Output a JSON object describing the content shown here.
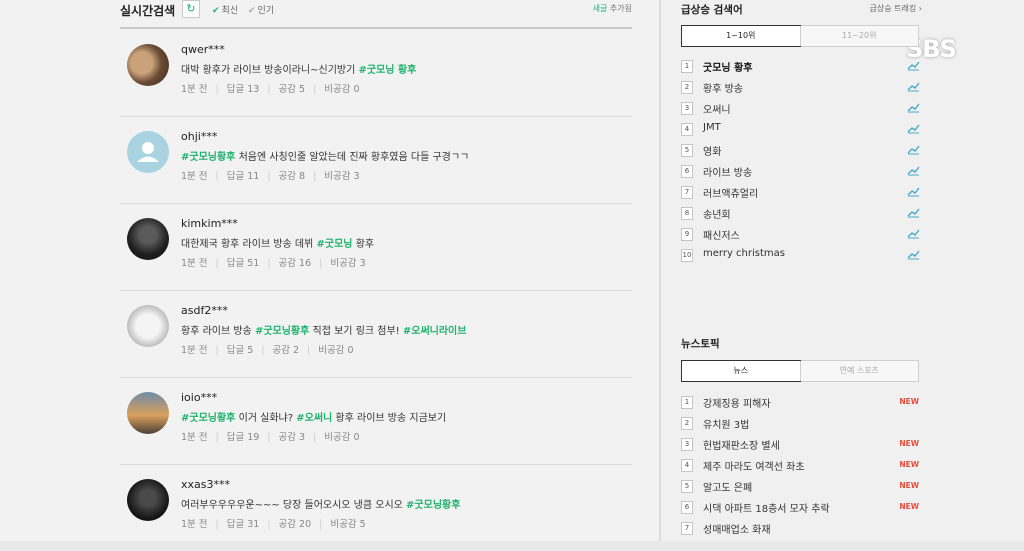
{
  "realtime": {
    "title": "실시간검색",
    "refresh_icon": "↻",
    "sort_latest": "최신",
    "sort_popular": "인기",
    "add_label": "추가됨",
    "add_prefix": "새글"
  },
  "posts": [
    {
      "user": "qwer***",
      "text": "대박 황후가 라이브 방송이라니~신기방기",
      "tags": [
        "#굿모닝 황후"
      ],
      "time": "1분 전",
      "replies": "답글 13",
      "likes": "공감 5",
      "dislikes": "비공감 0"
    },
    {
      "user": "ohji***",
      "text_after": "처음엔 사칭인줄 알았는데 진짜 황후였음 다들 구경ㄱㄱ",
      "lead_tag": "#굿모닝황후",
      "time": "1분 전",
      "replies": "답글 11",
      "likes": "공감 8",
      "dislikes": "비공감 3"
    },
    {
      "user": "kimkim***",
      "text": "대한제국 황후 라이브 방송 데뷔",
      "tag_mid": "#굿모닝",
      "text_after": "황후",
      "time": "1분 전",
      "replies": "답글 51",
      "likes": "공감 16",
      "dislikes": "비공감 3"
    },
    {
      "user": "asdf2***",
      "text": "황후 라이브 방송",
      "tag_mid": "#굿모닝황후",
      "text_after": "직접 보기 링크 첨부!",
      "tag_end": "#오써니라이브",
      "time": "1분 전",
      "replies": "답글 5",
      "likes": "공감 2",
      "dislikes": "비공감 0"
    },
    {
      "user": "ioio***",
      "lead_tag": "#굿모닝황후",
      "text": "이거 실화냐?",
      "tag_mid": "#오써니",
      "text_after": "황후 라이브 방송 지금보기",
      "time": "1분 전",
      "replies": "답글 19",
      "likes": "공감 3",
      "dislikes": "비공감 0"
    },
    {
      "user": "xxas3***",
      "text": "여러부우우우우운~~~ 당장 들어오시오 냉큼 오시오",
      "tag_end": "#굿모닝황후",
      "time": "1분 전",
      "replies": "답글 31",
      "likes": "공감 20",
      "dislikes": "비공감 5"
    }
  ],
  "rising": {
    "title": "급상승 검색어",
    "trend_link": "급상승 트래킹",
    "tab1": "1~10위",
    "tab2": "11~20위",
    "items": [
      "굿모닝 황후",
      "황후 방송",
      "오써니",
      "JMT",
      "영화",
      "라이브 방송",
      "러브액츄얼리",
      "송년회",
      "패신저스",
      "merry christmas"
    ],
    "ranks": [
      "1",
      "2",
      "3",
      "4",
      "5",
      "6",
      "7",
      "8",
      "9",
      "10"
    ]
  },
  "news": {
    "title": "뉴스토픽",
    "tab1": "뉴스",
    "tab2": "연예 스포츠",
    "new_label": "NEW",
    "items": [
      {
        "rank": "1",
        "text": "강제징용 피해자",
        "new": true
      },
      {
        "rank": "2",
        "text": "유치원 3법",
        "new": false
      },
      {
        "rank": "3",
        "text": "헌법재판소장 별세",
        "new": true
      },
      {
        "rank": "4",
        "text": "제주 마라도 여객선 좌초",
        "new": true
      },
      {
        "rank": "5",
        "text": "알고도 은폐",
        "new": true
      },
      {
        "rank": "6",
        "text": "시댁 아파트 18층서 모자 추락",
        "new": true
      },
      {
        "rank": "7",
        "text": "성매매업소 화재",
        "new": false
      }
    ]
  },
  "watermark": "SBS",
  "colors": {
    "accent": "#1eb26d",
    "new": "#e74c3c"
  }
}
